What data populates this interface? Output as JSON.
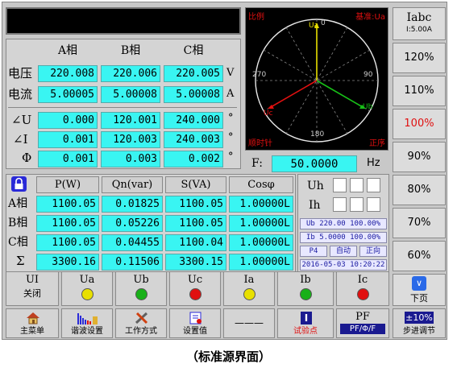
{
  "phase_headers": [
    "A相",
    "B相",
    "C相"
  ],
  "voltage": {
    "label": "电压",
    "values": [
      "220.008",
      "220.006",
      "220.005"
    ],
    "unit": "V"
  },
  "current": {
    "label": "电流",
    "values": [
      "5.00005",
      "5.00008",
      "5.00008"
    ],
    "unit": "A"
  },
  "angle_u": {
    "label": "∠U",
    "values": [
      "0.000",
      "120.001",
      "240.000"
    ],
    "unit": "°"
  },
  "angle_i": {
    "label": "∠I",
    "values": [
      "0.001",
      "120.003",
      "240.003"
    ],
    "unit": "°"
  },
  "phi": {
    "label": "Φ",
    "values": [
      "0.001",
      "0.003",
      "0.002"
    ],
    "unit": "°"
  },
  "phasor": {
    "scale_label": "比例",
    "ref_label": "基准:Ua",
    "rotation_label": "顺时针",
    "sequence_label": "正序",
    "deg_0": "0",
    "deg_90": "90",
    "deg_180": "180",
    "deg_270": "270",
    "ua": "Ua",
    "ub": "Ub",
    "uc": "Uc"
  },
  "freq": {
    "label": "F:",
    "value": "50.0000",
    "unit": "Hz"
  },
  "power_headers": [
    "P(W)",
    "Qn(var)",
    "S(VA)",
    "Cosφ"
  ],
  "power_rows": [
    {
      "label": "A相",
      "values": [
        "1100.05",
        "0.01825",
        "1100.05",
        "1.00000L"
      ]
    },
    {
      "label": "B相",
      "values": [
        "1100.05",
        "0.05226",
        "1100.05",
        "1.00000L"
      ]
    },
    {
      "label": "C相",
      "values": [
        "1100.05",
        "0.04455",
        "1100.04",
        "1.00000L"
      ]
    },
    {
      "label": "Σ",
      "values": [
        "3300.16",
        "0.11506",
        "3300.15",
        "1.00000L"
      ]
    }
  ],
  "side": {
    "uh": "Uh",
    "ih": "Ih",
    "ub_info": "Ub 220.00 100.00%",
    "ib_info": "Ib 5.0000 100.00%",
    "p4": "P4",
    "auto": "自动",
    "forward": "正向",
    "datetime": "2016-05-03 10:20:22"
  },
  "right_buttons": {
    "iabc": "Iabc",
    "iabc_sub": "I:5.00A",
    "items": [
      "120%",
      "110%",
      "100%",
      "90%",
      "80%",
      "70%",
      "60%"
    ],
    "active_color": "#e01010",
    "next_page": "下页"
  },
  "channels": {
    "ui_label": "UI",
    "ui_state": "关闭",
    "items": [
      {
        "label": "Ua",
        "color": "#e8e000"
      },
      {
        "label": "Ub",
        "color": "#18b018"
      },
      {
        "label": "Uc",
        "color": "#e01010"
      },
      {
        "label": "Ia",
        "color": "#e8e000"
      },
      {
        "label": "Ib",
        "color": "#18b018"
      },
      {
        "label": "Ic",
        "color": "#e01010"
      }
    ]
  },
  "bottom": {
    "main_menu": "主菜单",
    "harmonic": "谐波设置",
    "work_mode": "工作方式",
    "set_value": "设置值",
    "dashes": "———",
    "test_point": "试验点",
    "pf_title": "PF",
    "pf_sub": "PF/Φ/F",
    "step_title": "±10%",
    "step_label": "步进调节"
  },
  "caption": "（标准源界面）"
}
